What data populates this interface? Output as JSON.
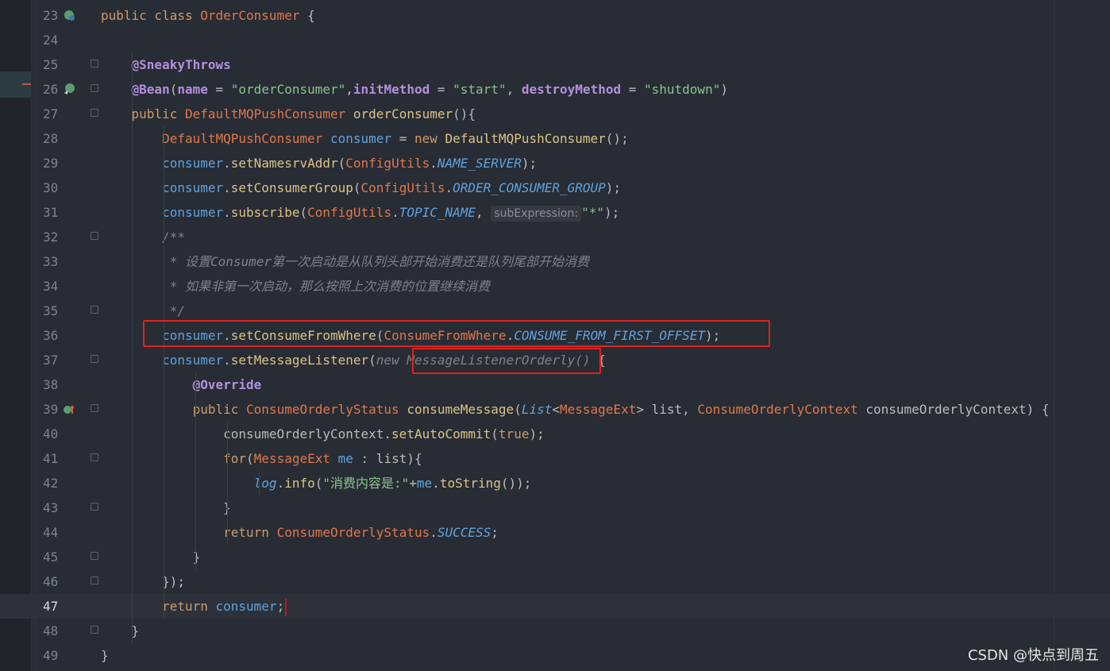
{
  "colors": {
    "background": "#282c34",
    "keyword": "#cc9c6b",
    "class": "#e0784d",
    "method": "#dbc488",
    "variable": "#5fa3e0",
    "string": "#89c38f",
    "annotation": "#b390df",
    "comment": "#7d828c",
    "highlight_box": "#e0211c"
  },
  "editor": {
    "current_line": 47,
    "lines": [
      {
        "num": "23",
        "segments": [
          {
            "t": "public class ",
            "c": "kw"
          },
          {
            "t": "OrderConsumer",
            "c": "cls"
          },
          {
            "t": " {",
            "c": ""
          }
        ]
      },
      {
        "num": "24",
        "segments": []
      },
      {
        "num": "25",
        "segments": [
          {
            "t": "    ",
            "c": ""
          },
          {
            "t": "@SneakyThrows",
            "c": "ann"
          }
        ]
      },
      {
        "num": "26",
        "segments": [
          {
            "t": "    ",
            "c": ""
          },
          {
            "t": "@Bean",
            "c": "ann"
          },
          {
            "t": "(",
            "c": ""
          },
          {
            "t": "name",
            "c": "param"
          },
          {
            "t": " = ",
            "c": ""
          },
          {
            "t": "\"orderConsumer\"",
            "c": "str"
          },
          {
            "t": ",",
            "c": ""
          },
          {
            "t": "initMethod",
            "c": "param"
          },
          {
            "t": " = ",
            "c": ""
          },
          {
            "t": "\"start\"",
            "c": "str"
          },
          {
            "t": ", ",
            "c": ""
          },
          {
            "t": "destroyMethod",
            "c": "param"
          },
          {
            "t": " = ",
            "c": ""
          },
          {
            "t": "\"shutdown\"",
            "c": "str"
          },
          {
            "t": ")",
            "c": ""
          }
        ]
      },
      {
        "num": "27",
        "segments": [
          {
            "t": "    ",
            "c": ""
          },
          {
            "t": "public ",
            "c": "kw"
          },
          {
            "t": "DefaultMQPushConsumer",
            "c": "cls"
          },
          {
            "t": " ",
            "c": ""
          },
          {
            "t": "orderConsumer",
            "c": "fn"
          },
          {
            "t": "(){",
            "c": ""
          }
        ]
      },
      {
        "num": "28",
        "segments": [
          {
            "t": "        ",
            "c": ""
          },
          {
            "t": "DefaultMQPushConsumer",
            "c": "cls"
          },
          {
            "t": " ",
            "c": ""
          },
          {
            "t": "consumer",
            "c": "var"
          },
          {
            "t": " = ",
            "c": ""
          },
          {
            "t": "new ",
            "c": "kw"
          },
          {
            "t": "DefaultMQPushConsumer",
            "c": "fn"
          },
          {
            "t": "();",
            "c": ""
          }
        ]
      },
      {
        "num": "29",
        "segments": [
          {
            "t": "        ",
            "c": ""
          },
          {
            "t": "consumer",
            "c": "var"
          },
          {
            "t": ".",
            "c": ""
          },
          {
            "t": "setNamesrvAddr",
            "c": "fn"
          },
          {
            "t": "(",
            "c": ""
          },
          {
            "t": "ConfigUtils",
            "c": "cls"
          },
          {
            "t": ".",
            "c": ""
          },
          {
            "t": "NAME_SERVER",
            "c": "const"
          },
          {
            "t": ");",
            "c": ""
          }
        ]
      },
      {
        "num": "30",
        "segments": [
          {
            "t": "        ",
            "c": ""
          },
          {
            "t": "consumer",
            "c": "var"
          },
          {
            "t": ".",
            "c": ""
          },
          {
            "t": "setConsumerGroup",
            "c": "fn"
          },
          {
            "t": "(",
            "c": ""
          },
          {
            "t": "ConfigUtils",
            "c": "cls"
          },
          {
            "t": ".",
            "c": ""
          },
          {
            "t": "ORDER_CONSUMER_GROUP",
            "c": "const"
          },
          {
            "t": ");",
            "c": ""
          }
        ]
      },
      {
        "num": "31",
        "segments": [
          {
            "t": "        ",
            "c": ""
          },
          {
            "t": "consumer",
            "c": "var"
          },
          {
            "t": ".",
            "c": ""
          },
          {
            "t": "subscribe",
            "c": "fn"
          },
          {
            "t": "(",
            "c": ""
          },
          {
            "t": "ConfigUtils",
            "c": "cls"
          },
          {
            "t": ".",
            "c": ""
          },
          {
            "t": "TOPIC_NAME",
            "c": "const"
          },
          {
            "t": ", ",
            "c": ""
          },
          {
            "t": "subExpression:",
            "c": "hint"
          },
          {
            "t": "\"*\"",
            "c": "str"
          },
          {
            "t": ");",
            "c": ""
          }
        ]
      },
      {
        "num": "32",
        "segments": [
          {
            "t": "        ",
            "c": ""
          },
          {
            "t": "/**",
            "c": "cmt"
          }
        ]
      },
      {
        "num": "33",
        "segments": [
          {
            "t": "         ",
            "c": ""
          },
          {
            "t": "* 设置Consumer第一次启动是从队列头部开始消费还是队列尾部开始消费",
            "c": "cmt"
          }
        ]
      },
      {
        "num": "34",
        "segments": [
          {
            "t": "         ",
            "c": ""
          },
          {
            "t": "* 如果非第一次启动，那么按照上次消费的位置继续消费",
            "c": "cmt"
          }
        ]
      },
      {
        "num": "35",
        "segments": [
          {
            "t": "         ",
            "c": ""
          },
          {
            "t": "*/",
            "c": "cmt"
          }
        ]
      },
      {
        "num": "36",
        "segments": [
          {
            "t": "        ",
            "c": ""
          },
          {
            "t": "consumer",
            "c": "var"
          },
          {
            "t": ".",
            "c": ""
          },
          {
            "t": "setConsumeFromWhere",
            "c": "fn"
          },
          {
            "t": "(",
            "c": ""
          },
          {
            "t": "ConsumeFromWhere",
            "c": "cls"
          },
          {
            "t": ".",
            "c": ""
          },
          {
            "t": "CONSUME_FROM_FIRST_OFFSET",
            "c": "const"
          },
          {
            "t": ");",
            "c": ""
          }
        ]
      },
      {
        "num": "37",
        "segments": [
          {
            "t": "        ",
            "c": ""
          },
          {
            "t": "consumer",
            "c": "var"
          },
          {
            "t": ".",
            "c": ""
          },
          {
            "t": "setMessageListener",
            "c": "fn"
          },
          {
            "t": "(",
            "c": ""
          },
          {
            "t": "new ",
            "c": "cmt"
          },
          {
            "t": "MessageListenerOrderly",
            "c": "cmt"
          },
          {
            "t": "()",
            "c": "cmt"
          },
          {
            "t": " {",
            "c": ""
          }
        ]
      },
      {
        "num": "38",
        "segments": [
          {
            "t": "            ",
            "c": ""
          },
          {
            "t": "@Override",
            "c": "ann"
          }
        ]
      },
      {
        "num": "39",
        "segments": [
          {
            "t": "            ",
            "c": ""
          },
          {
            "t": "public ",
            "c": "kw"
          },
          {
            "t": "ConsumeOrderlyStatus",
            "c": "cls"
          },
          {
            "t": " ",
            "c": ""
          },
          {
            "t": "consumeMessage",
            "c": "fn"
          },
          {
            "t": "(",
            "c": ""
          },
          {
            "t": "List",
            "c": "const"
          },
          {
            "t": "<",
            "c": ""
          },
          {
            "t": "MessageExt",
            "c": "cls"
          },
          {
            "t": "> list, ",
            "c": ""
          },
          {
            "t": "ConsumeOrderlyContext",
            "c": "cls"
          },
          {
            "t": " consumeOrderlyContext) {",
            "c": ""
          }
        ]
      },
      {
        "num": "40",
        "segments": [
          {
            "t": "                ",
            "c": ""
          },
          {
            "t": "consumeOrderlyContext.",
            "c": ""
          },
          {
            "t": "setAutoCommit",
            "c": "fn"
          },
          {
            "t": "(",
            "c": ""
          },
          {
            "t": "true",
            "c": "kw"
          },
          {
            "t": ");",
            "c": ""
          }
        ]
      },
      {
        "num": "41",
        "segments": [
          {
            "t": "                ",
            "c": ""
          },
          {
            "t": "for",
            "c": "kw"
          },
          {
            "t": "(",
            "c": ""
          },
          {
            "t": "MessageExt",
            "c": "cls"
          },
          {
            "t": " ",
            "c": ""
          },
          {
            "t": "me",
            "c": "var"
          },
          {
            "t": " : list){",
            "c": ""
          }
        ]
      },
      {
        "num": "42",
        "segments": [
          {
            "t": "                    ",
            "c": ""
          },
          {
            "t": "log",
            "c": "const"
          },
          {
            "t": ".",
            "c": ""
          },
          {
            "t": "info",
            "c": "fn"
          },
          {
            "t": "(",
            "c": ""
          },
          {
            "t": "\"消费内容是:\"",
            "c": "str"
          },
          {
            "t": "+",
            "c": ""
          },
          {
            "t": "me",
            "c": "var"
          },
          {
            "t": ".",
            "c": ""
          },
          {
            "t": "toString",
            "c": "fn"
          },
          {
            "t": "());",
            "c": ""
          }
        ]
      },
      {
        "num": "43",
        "segments": [
          {
            "t": "                ",
            "c": ""
          },
          {
            "t": "}",
            "c": ""
          }
        ]
      },
      {
        "num": "44",
        "segments": [
          {
            "t": "                ",
            "c": ""
          },
          {
            "t": "return ",
            "c": "kw"
          },
          {
            "t": "ConsumeOrderlyStatus",
            "c": "cls"
          },
          {
            "t": ".",
            "c": ""
          },
          {
            "t": "SUCCESS",
            "c": "const"
          },
          {
            "t": ";",
            "c": ""
          }
        ]
      },
      {
        "num": "45",
        "segments": [
          {
            "t": "            ",
            "c": ""
          },
          {
            "t": "}",
            "c": ""
          }
        ]
      },
      {
        "num": "46",
        "segments": [
          {
            "t": "        ",
            "c": ""
          },
          {
            "t": "});",
            "c": ""
          }
        ]
      },
      {
        "num": "47",
        "segments": [
          {
            "t": "        ",
            "c": ""
          },
          {
            "t": "return ",
            "c": "kw"
          },
          {
            "t": "consumer",
            "c": "var"
          },
          {
            "t": ";",
            "c": ""
          }
        ]
      },
      {
        "num": "48",
        "segments": [
          {
            "t": "    ",
            "c": ""
          },
          {
            "t": "}",
            "c": ""
          }
        ]
      },
      {
        "num": "49",
        "segments": [
          {
            "t": "}",
            "c": ""
          }
        ]
      }
    ],
    "fold_lines": [
      "25",
      "26",
      "27",
      "32",
      "35",
      "37",
      "39",
      "41",
      "43",
      "45",
      "46",
      "48"
    ],
    "gutter_icons": [
      {
        "line": "23",
        "name": "bean-class-icon"
      },
      {
        "line": "26",
        "name": "bean-method-icon"
      },
      {
        "line": "39",
        "name": "override-method-icon"
      }
    ]
  },
  "watermark": "CSDN @快点到周五"
}
